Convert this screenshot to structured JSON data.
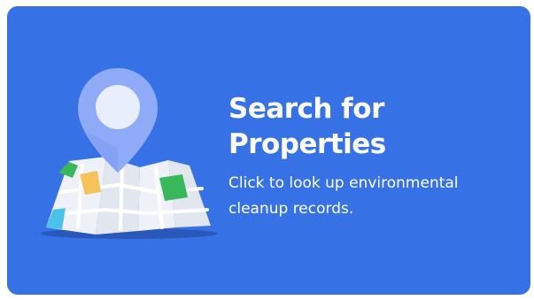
{
  "card": {
    "title_line1": "Search for",
    "title_line2": "Properties",
    "description_line1": "Click to look up environmental",
    "description_line2": "cleanup records.",
    "icon": "map-pin-icon"
  },
  "colors": {
    "card_background": "#3672E6",
    "text": "#FFFFFF",
    "pin_outer": "#8FABF7",
    "pin_inner": "#E9EEFD",
    "map_base": "#F1F3F8",
    "map_green": "#38B85A",
    "map_orange": "#F6C35A",
    "map_blue": "#4BC2EA",
    "map_shadow": "#2958BA"
  }
}
